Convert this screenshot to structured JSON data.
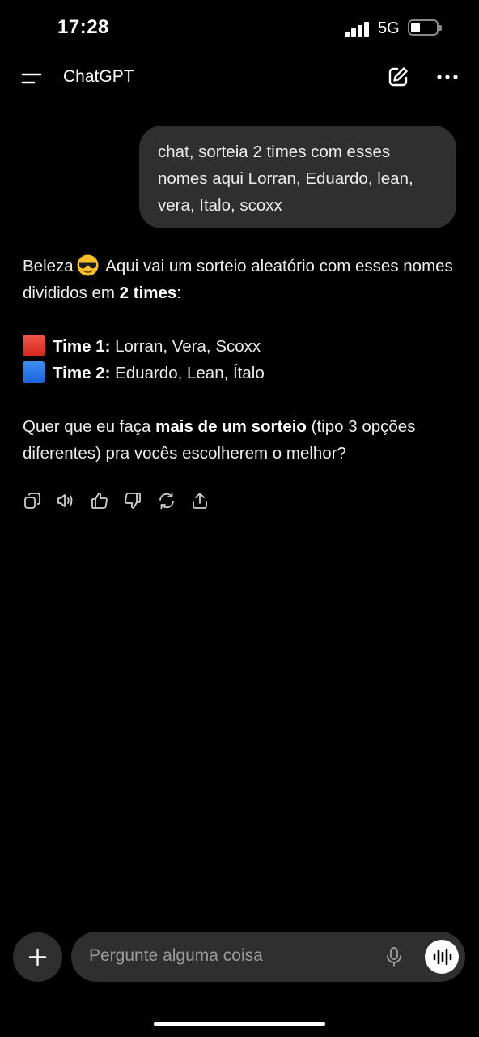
{
  "status_bar": {
    "time": "17:28",
    "network": "5G",
    "battery_level": 0.35
  },
  "header": {
    "title": "ChatGPT",
    "icons": [
      "menu-icon",
      "new-chat-icon",
      "more-icon"
    ]
  },
  "conversation": {
    "user_message": "chat, sorteia 2 times com esses nomes aqui Lorran, Eduardo, lean, vera, Italo, scoxx",
    "assistant": {
      "intro_1": "Beleza",
      "intro_emoji": "😎",
      "intro_2": " Aqui vai um sorteio aleatório com esses nomes divididos em ",
      "intro_bold": "2 times",
      "intro_end": ":",
      "team1_label": "Time 1:",
      "team1_members": " Lorran, Vera, Scoxx",
      "team2_label": "Time 2:",
      "team2_members": " Eduardo, Lean, Ítalo",
      "question_1": "Quer que eu faça ",
      "question_bold": "mais de um sorteio",
      "question_2": " (tipo 3 opções diferentes) pra vocês escolherem o melhor?"
    },
    "action_icons": [
      "copy-icon",
      "read-aloud-icon",
      "thumbs-up-icon",
      "thumbs-down-icon",
      "regenerate-icon",
      "share-icon"
    ]
  },
  "composer": {
    "placeholder": "Pergunte alguma coisa"
  },
  "colors": {
    "background": "#000000",
    "bubble": "#2f2f2f",
    "team1": "#e33b2e",
    "team2": "#2a7bef"
  }
}
